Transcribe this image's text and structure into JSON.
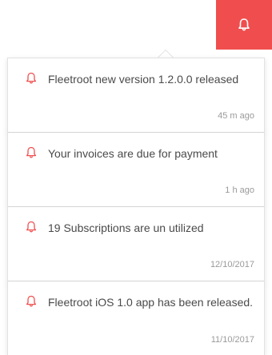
{
  "accent_color": "#f04e4e",
  "header": {
    "bell_icon": "bell-icon"
  },
  "notifications": [
    {
      "icon": "bell-icon",
      "text": "Fleetroot new version 1.2.0.0 released",
      "time": "45 m ago"
    },
    {
      "icon": "bell-icon",
      "text": "Your invoices are due for payment",
      "time": "1 h ago"
    },
    {
      "icon": "bell-icon",
      "text": "19 Subscriptions are un utilized",
      "time": "12/10/2017"
    },
    {
      "icon": "bell-icon",
      "text": "Fleetroot iOS 1.0 app has been released.",
      "time": "11/10/2017"
    }
  ]
}
